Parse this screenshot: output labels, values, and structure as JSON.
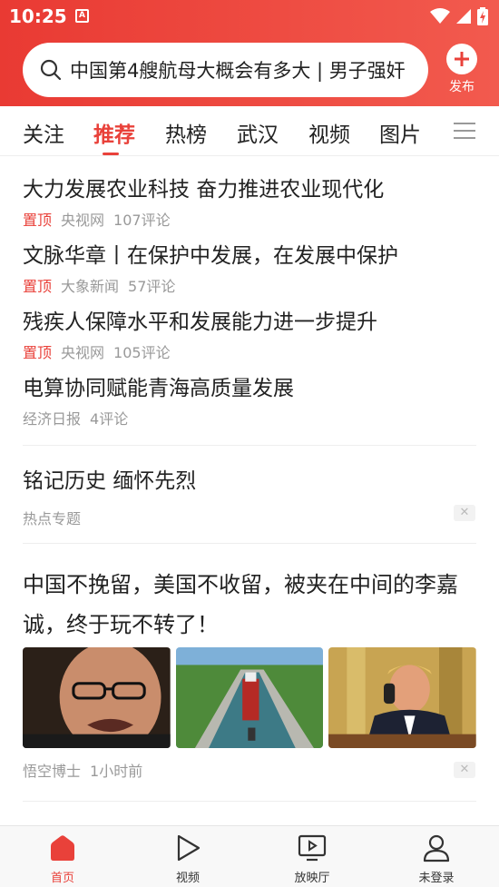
{
  "status_bar": {
    "time": "10:25",
    "notification_letter": "A"
  },
  "search": {
    "text": "中国第4艘航母大概会有多大 | 男子强奸"
  },
  "publish": {
    "label": "发布"
  },
  "tabs": [
    {
      "label": "关注"
    },
    {
      "label": "推荐",
      "active": true
    },
    {
      "label": "热榜"
    },
    {
      "label": "武汉"
    },
    {
      "label": "视频"
    },
    {
      "label": "图片"
    }
  ],
  "news": [
    {
      "title": "大力发展农业科技 奋力推进农业现代化",
      "tag": "置顶",
      "source": "央视网",
      "comments": "107评论"
    },
    {
      "title": "文脉华章丨在保护中发展，在发展中保护",
      "tag": "置顶",
      "source": "大象新闻",
      "comments": "57评论"
    },
    {
      "title": "残疾人保障水平和发展能力进一步提升",
      "tag": "置顶",
      "source": "央视网",
      "comments": "105评论"
    },
    {
      "title": "电算协同赋能青海高质量发展",
      "source": "经济日报",
      "comments": "4评论"
    }
  ],
  "topic": {
    "title": "铭记历史 缅怀先烈",
    "source": "热点专题"
  },
  "article": {
    "title": "中国不挽留，美国不收留，被夹在中间的李嘉诚，终于玩不转了！",
    "source": "悟空博士",
    "time": "1小时前"
  },
  "close_glyph": "✕",
  "bottom_nav": [
    {
      "label": "首页",
      "icon": "home-icon",
      "active": true
    },
    {
      "label": "视频",
      "icon": "play-icon"
    },
    {
      "label": "放映厅",
      "icon": "screen-icon"
    },
    {
      "label": "未登录",
      "icon": "user-icon"
    }
  ],
  "colors": {
    "accent": "#e9413a",
    "header_start": "#e93a33",
    "header_end": "#f25a4e",
    "meta_gray": "#999999"
  }
}
